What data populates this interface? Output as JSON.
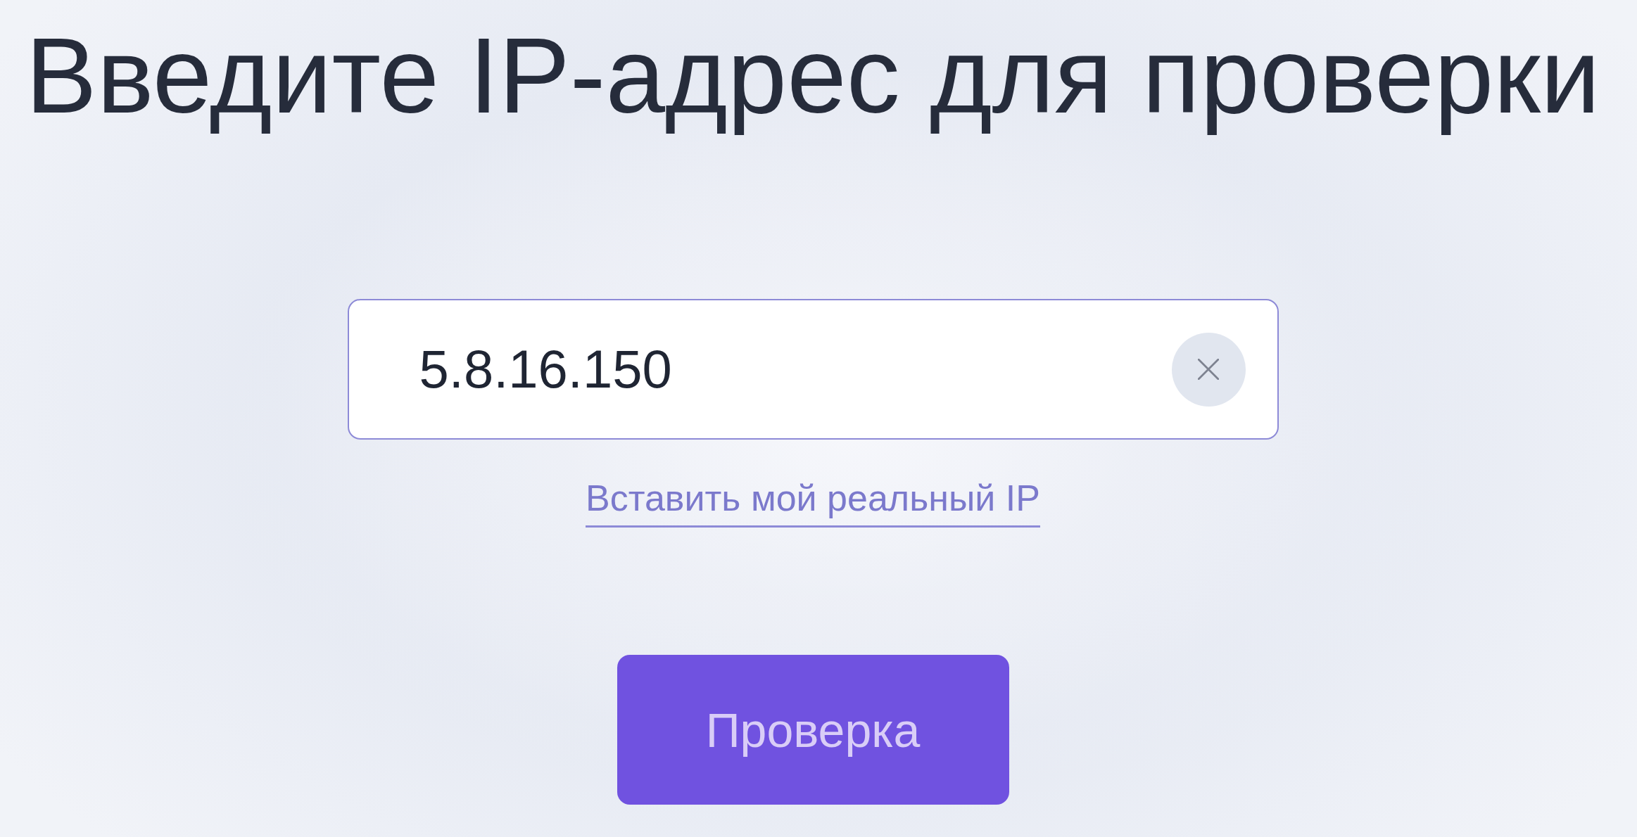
{
  "title": "Введите IP-адрес для проверки",
  "ip_field": {
    "value": "5.8.16.150"
  },
  "paste_link": {
    "label": "Вставить мой реальный IP"
  },
  "submit_button": {
    "label": "Проверка"
  }
}
